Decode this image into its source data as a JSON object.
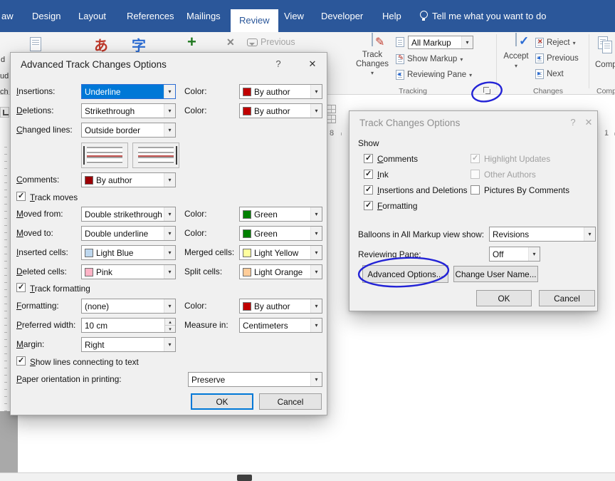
{
  "colors": {
    "ribbon_blue": "#2b579a",
    "selection_blue": "#0078d7",
    "annotation_blue": "#2323d6",
    "by_author_red": "#c00000",
    "comments_author_red": "#9c0006",
    "green": "#008000",
    "light_blue": "#bdd7ee",
    "light_yellow": "#ffff9e",
    "pink": "#ffb3c6",
    "light_orange": "#ffcc99"
  },
  "icons": {
    "chevron_down": "▾",
    "chevron_up": "▴",
    "close": "✕",
    "help": "?",
    "translate_red": "あ",
    "translate_blue": "字",
    "new_comment_plus": "+",
    "delete_x": "✕"
  },
  "tabs": {
    "items": [
      "aw",
      "Design",
      "Layout",
      "References",
      "Mailings",
      "Review",
      "View",
      "Developer",
      "Help"
    ],
    "tell_me": "Tell me what you want to do"
  },
  "ribbon": {
    "left_fragments": [
      "d",
      "ud",
      "ch"
    ],
    "comments_previous": "Previous",
    "tracking": {
      "track": "Track",
      "changes": "Changes",
      "all_markup": "All Markup",
      "show_markup": "Show Markup",
      "reviewing_pane": "Reviewing Pane",
      "group": "Tracking"
    },
    "changes": {
      "accept": "Accept",
      "reject": "Reject",
      "previous": "Previous",
      "next": "Next",
      "group": "Changes"
    },
    "compare": {
      "button": "Comp",
      "group": "Comp"
    }
  },
  "ruler": {
    "left_number": "8",
    "right_number": "1"
  },
  "advanced": {
    "title": "Advanced Track Changes Options",
    "color_label": "Color:",
    "insertions": {
      "label": "Insertions:",
      "value": "Underline",
      "color": "By author"
    },
    "deletions": {
      "label": "Deletions:",
      "value": "Strikethrough",
      "color": "By author"
    },
    "changed_lines": {
      "label": "Changed lines:",
      "value": "Outside border"
    },
    "comments": {
      "label": "Comments:",
      "value": "By author"
    },
    "track_moves": {
      "label": "Track moves",
      "checked": true
    },
    "moved_from": {
      "label": "Moved from:",
      "value": "Double strikethrough",
      "color": "Green"
    },
    "moved_to": {
      "label": "Moved to:",
      "value": "Double underline",
      "color": "Green"
    },
    "inserted_cells": {
      "label": "Inserted cells:",
      "value": "Light Blue"
    },
    "merged_cells": {
      "label": "Merged cells:",
      "value": "Light Yellow"
    },
    "deleted_cells": {
      "label": "Deleted cells:",
      "value": "Pink"
    },
    "split_cells": {
      "label": "Split cells:",
      "value": "Light Orange"
    },
    "track_formatting": {
      "label": "Track formatting",
      "checked": true
    },
    "formatting": {
      "label": "Formatting:",
      "value": "(none)",
      "color": "By author"
    },
    "preferred_width": {
      "label": "Preferred width:",
      "value": "10 cm"
    },
    "measure_in": {
      "label": "Measure in:",
      "value": "Centimeters"
    },
    "margin": {
      "label": "Margin:",
      "value": "Right"
    },
    "show_lines": {
      "label": "Show lines connecting to text",
      "checked": true
    },
    "paper": {
      "label": "Paper orientation in printing:",
      "value": "Preserve"
    },
    "ok": "OK",
    "cancel": "Cancel"
  },
  "options": {
    "title": "Track Changes Options",
    "show": "Show",
    "checkboxes": {
      "comments": {
        "label": "Comments",
        "checked": true
      },
      "highlight_updates": {
        "label": "Highlight Updates",
        "checked": true
      },
      "ink": {
        "label": "Ink",
        "checked": true
      },
      "other_authors": {
        "label": "Other Authors",
        "checked": false
      },
      "insertions_deletions": {
        "label": "Insertions and Deletions",
        "checked": true
      },
      "pictures": {
        "label": "Pictures By Comments",
        "checked": false
      },
      "formatting": {
        "label": "Formatting",
        "checked": true
      }
    },
    "balloons": {
      "label": "Balloons in All Markup view show:",
      "value": "Revisions"
    },
    "reviewing_pane": {
      "label": "Reviewing Pane:",
      "value": "Off"
    },
    "advanced_button": "Advanced Options...",
    "change_user_button": "Change User Name...",
    "ok": "OK",
    "cancel": "Cancel"
  }
}
